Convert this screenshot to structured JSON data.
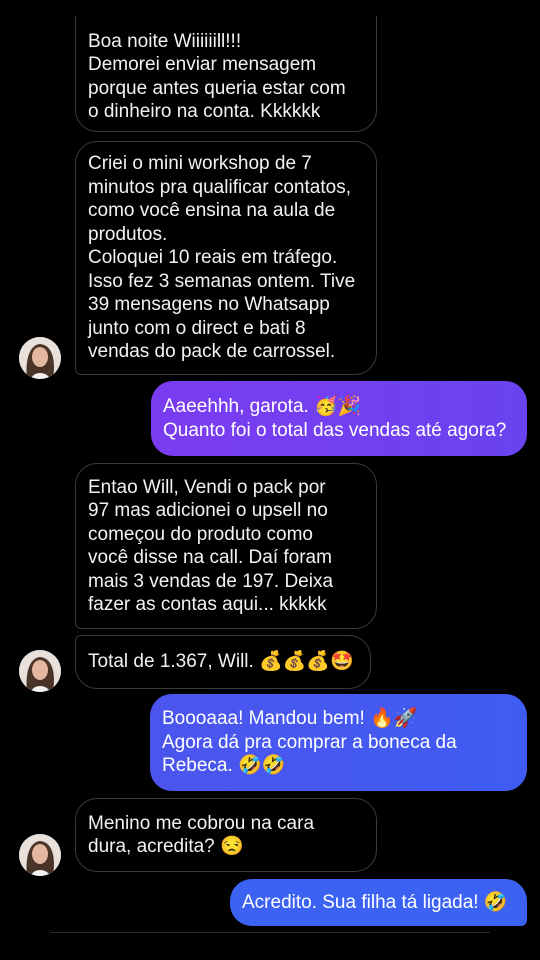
{
  "messages": [
    {
      "id": "m1",
      "text": "Boa noite Wiiiiiill!!!\nDemorei enviar mensagem\nporque antes queria estar com\no dinheiro na conta. Kkkkkk"
    },
    {
      "id": "m2",
      "text": "Criei o mini workshop de 7\nminutos pra qualificar contatos,\ncomo você ensina na aula de\nprodutos.\nColoquei 10 reais em tráfego.\nIsso fez 3 semanas ontem. Tive\n39 mensagens no Whatsapp\njunto com o direct e bati 8\nvendas do pack de carrossel."
    },
    {
      "id": "m3",
      "text": "Aaeehhh, garota. 🥳🎉\nQuanto foi o total das vendas até agora?"
    },
    {
      "id": "m4",
      "text": "Entao Will, Vendi o pack por\n97 mas adicionei o upsell no\ncomeçou do produto como\nvocê disse na call. Daí foram\nmais 3 vendas de 197. Deixa\nfazer as contas aqui... kkkkk"
    },
    {
      "id": "m5",
      "text": "Total de 1.367, Will. 💰💰💰🤩"
    },
    {
      "id": "m6",
      "text": "Boooaaa! Mandou bem! 🔥🚀\nAgora dá pra comprar a boneca da\nRebeca. 🤣🤣"
    },
    {
      "id": "m7",
      "text": "Menino me cobrou na cara\ndura, acredita? 😒"
    },
    {
      "id": "m8",
      "text": "Acredito. Sua filha tá ligada! 🤣"
    }
  ],
  "colors": {
    "background": "#000000",
    "incoming_border": "#3a3a3a",
    "outgoing_purple": "#7b3cf0",
    "outgoing_blue": "#3f5cf2"
  },
  "icons": {
    "avatar": "avatar-photo"
  }
}
